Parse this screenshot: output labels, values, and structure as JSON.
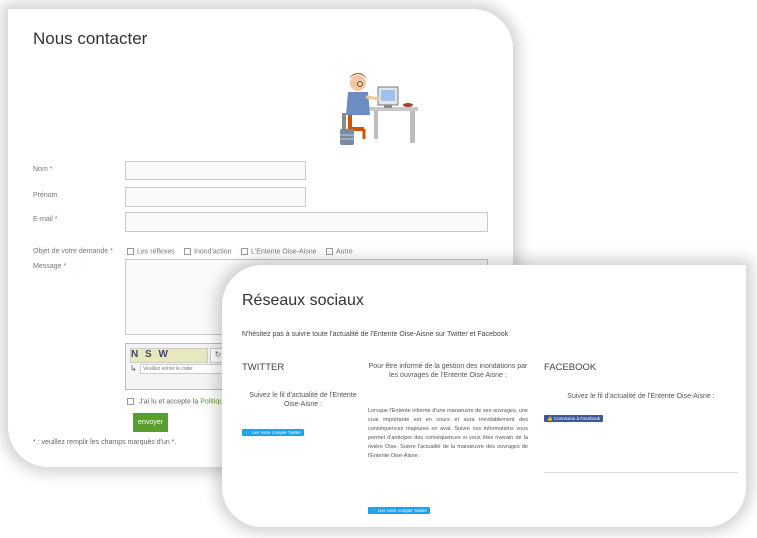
{
  "contact": {
    "title": "Nous contacter",
    "fields": {
      "nom": {
        "label": "Nom",
        "required": "*"
      },
      "prenom": {
        "label": "Prénom"
      },
      "email": {
        "label": "E-mail",
        "required": "*"
      },
      "objet": {
        "label": "Objet de votre demande",
        "required": "*"
      },
      "message": {
        "label": "Message",
        "required": "*"
      }
    },
    "options": [
      "Les réflexes",
      "Inond'action",
      "L'Entente Oise-Aisne",
      "Autre"
    ],
    "captcha": {
      "code_text": "N S W",
      "placeholder": "Veuillez entrer le code:"
    },
    "accept": {
      "prefix": "J'ai lu et accepte la",
      "link": "Politique"
    },
    "send_label": "envoyer",
    "footnote": "* : veuillez remplir les champs marqués d'un *."
  },
  "social": {
    "title": "Réseaux sociaux",
    "intro": "N'hésitez pas à suivre toute l'actualité de l'Entente Oise-Aisne sur Twitter et Facebook",
    "twitter": {
      "title": "TWITTER",
      "text": "Suivez le fil d'actualité de l'Entente Oise-Aisne :",
      "button": "Lier votre compte Twitter"
    },
    "middle": {
      "heading": "Pour être informé de la gestion des inondations par les ouvrages de l'Entente Oise Aisne :",
      "body": "Lorsque l'Entente informe d'une manœuvre de ses ouvrages, une crue importante est en cours et aura inévitablement des conséquences majeures en aval. Suivre ces informations vous permet d'anticiper des conséquences si vous êtes riverain de la rivière Oise. Suivre l'actualité de la manœuvre des ouvrages de l'Entente Oise-Aisne :",
      "button": "Lier votre compte Twitter"
    },
    "facebook": {
      "title": "FACEBOOK",
      "text": "Suivez le fil d'actualité de l'Entente Oise-Aisne :",
      "button": "Connexion à Facebook"
    }
  },
  "colors": {
    "accent_green": "#5a9e2e",
    "twitter_blue": "#1da1f2",
    "facebook_blue": "#3b5998",
    "required_red": "#d9534f"
  }
}
